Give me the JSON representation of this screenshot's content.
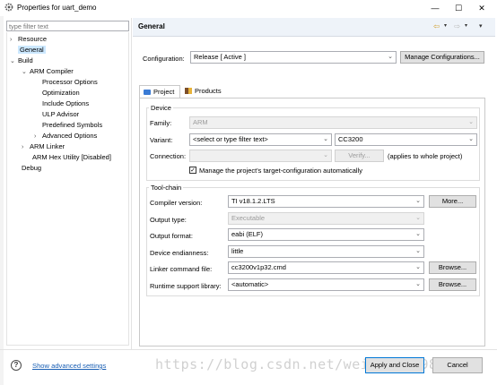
{
  "window": {
    "title": "Properties for uart_demo",
    "minimize": "—",
    "maximize": "☐",
    "close": "✕"
  },
  "tree": {
    "filter_placeholder": "type filter text",
    "nodes": [
      {
        "label": "Resource",
        "arrow": "›"
      },
      {
        "label": "General",
        "arrow": ""
      },
      {
        "label": "Build",
        "arrow": "⌄"
      },
      {
        "label": "ARM Compiler",
        "arrow": "⌄"
      },
      {
        "label": "Processor Options",
        "arrow": ""
      },
      {
        "label": "Optimization",
        "arrow": ""
      },
      {
        "label": "Include Options",
        "arrow": ""
      },
      {
        "label": "ULP Advisor",
        "arrow": ""
      },
      {
        "label": "Predefined Symbols",
        "arrow": ""
      },
      {
        "label": "Advanced Options",
        "arrow": "›"
      },
      {
        "label": "ARM Linker",
        "arrow": "›"
      },
      {
        "label": "ARM Hex Utility  [Disabled]",
        "arrow": ""
      },
      {
        "label": "Debug",
        "arrow": ""
      }
    ]
  },
  "header": {
    "title": "General",
    "back_icon": "⇦",
    "forward_icon": "⇨",
    "menu_icon": "▾",
    "drop": "▾"
  },
  "configuration": {
    "label": "Configuration:",
    "value": "Release  [ Active ]",
    "manage_label": "Manage Configurations..."
  },
  "tabs": {
    "project": "Project",
    "products": "Products"
  },
  "device": {
    "group_title": "Device",
    "family_label": "Family:",
    "family_value": "ARM",
    "variant_label": "Variant:",
    "variant_filter": "<select or type filter text>",
    "variant_value": "CC3200",
    "connection_label": "Connection:",
    "connection_value": "",
    "verify_label": "Verify...",
    "applies_note": "(applies to whole project)",
    "manage_target_label": "Manage the project's target-configuration automatically",
    "manage_target_checked": true
  },
  "toolchain": {
    "group_title": "Tool-chain",
    "compiler_version_label": "Compiler version:",
    "compiler_version_value": "TI v18.1.2.LTS",
    "more_label": "More...",
    "output_type_label": "Output type:",
    "output_type_value": "Executable",
    "output_format_label": "Output format:",
    "output_format_value": "eabi (ELF)",
    "endianness_label": "Device endianness:",
    "endianness_value": "little",
    "linker_cmd_label": "Linker command file:",
    "linker_cmd_value": "cc3200v1p32.cmd",
    "browse1_label": "Browse...",
    "runtime_lib_label": "Runtime support library:",
    "runtime_lib_value": "<automatic>",
    "browse2_label": "Browse..."
  },
  "footer": {
    "help_icon": "?",
    "advanced_link": "Show advanced settings",
    "watermark": "https://blog.csdn.net/weixin_41980846",
    "apply_close": "Apply and Close",
    "cancel": "Cancel"
  }
}
